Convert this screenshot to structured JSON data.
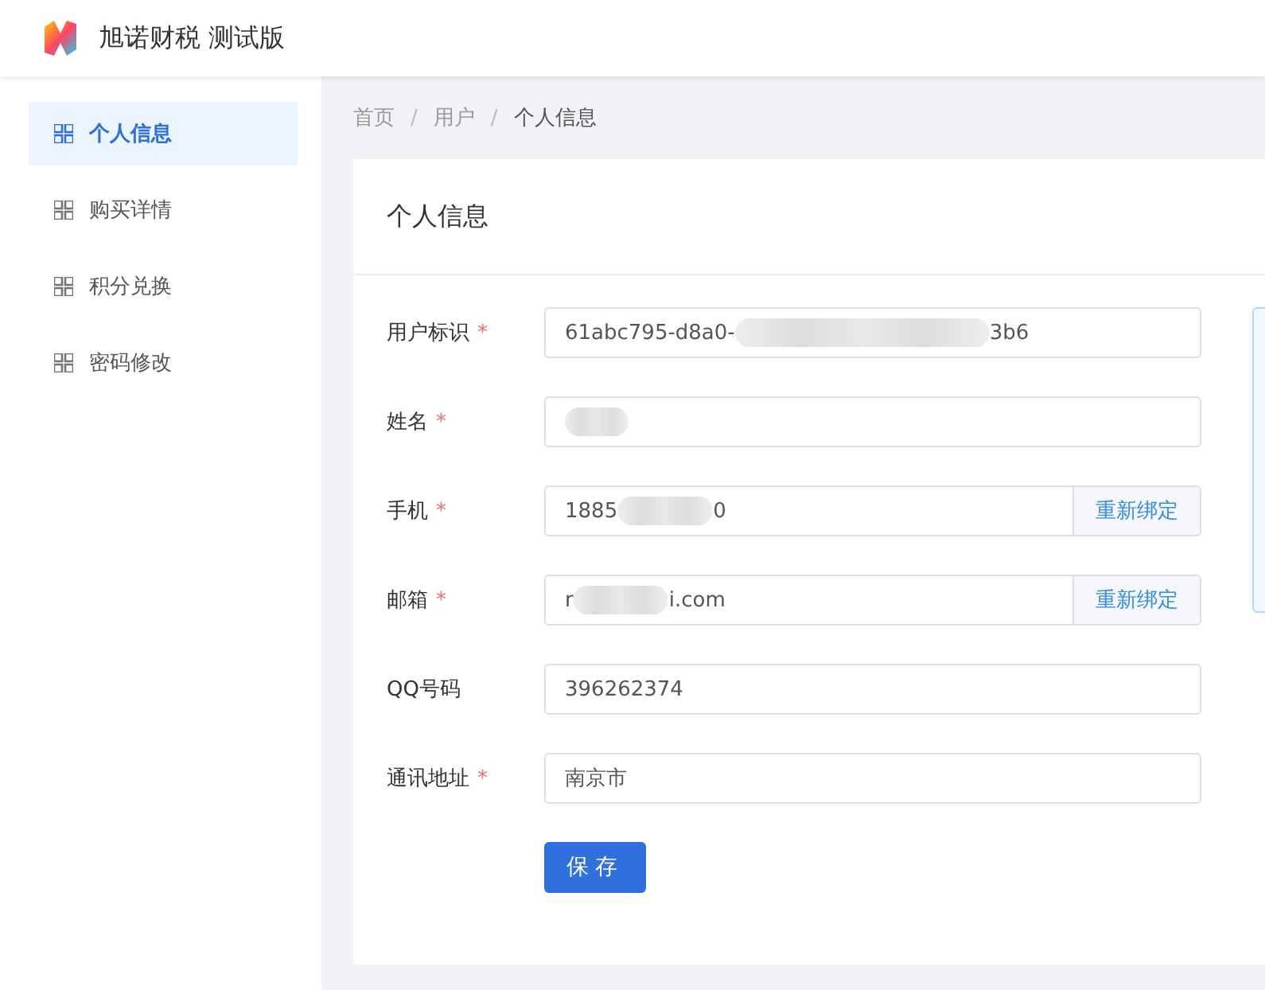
{
  "app": {
    "title": "旭诺财税 测试版"
  },
  "sidebar": {
    "items": [
      {
        "label": "个人信息",
        "selected": true
      },
      {
        "label": "购买详情",
        "selected": false
      },
      {
        "label": "积分兑换",
        "selected": false
      },
      {
        "label": "密码修改",
        "selected": false
      }
    ]
  },
  "breadcrumb": {
    "separator": "/",
    "items": [
      "首页",
      "用户",
      "个人信息"
    ]
  },
  "card": {
    "title": "个人信息"
  },
  "form": {
    "fields": [
      {
        "label": "用户标识",
        "required_mark": "*",
        "value_start": "61abc795-d8a0-",
        "redacted": true,
        "value_end": "3b6"
      },
      {
        "label": "姓名",
        "required_mark": "*",
        "redacted": true
      },
      {
        "label": "手机",
        "required_mark": "*",
        "value_start": "1885",
        "redacted": true,
        "value_end": "0",
        "action": "重新绑定"
      },
      {
        "label": "邮箱",
        "required_mark": "*",
        "value_start": "r",
        "redacted": true,
        "value_end": "i.com",
        "action": "重新绑定"
      },
      {
        "label": "QQ号码",
        "value_start": "396262374",
        "redacted": false
      },
      {
        "label": "通讯地址",
        "required_mark": "*",
        "value_start": "南京市",
        "redacted": false
      }
    ],
    "submit": "保存"
  }
}
